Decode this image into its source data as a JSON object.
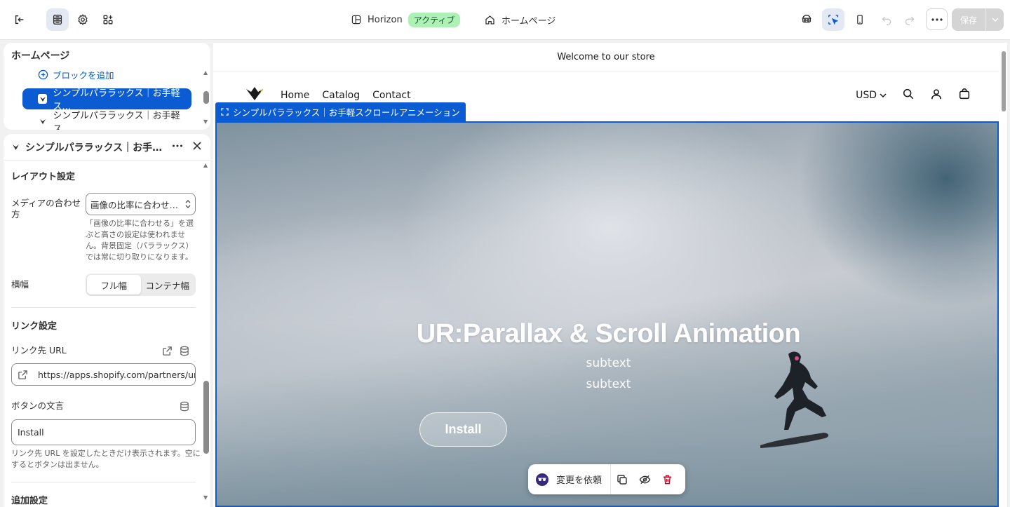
{
  "topbar": {
    "theme_name": "Horizon",
    "theme_status": "アクティブ",
    "page_name": "ホームページ",
    "save_label": "保存"
  },
  "sections_panel": {
    "title": "ホームページ",
    "add_block_label": "ブロックを追加",
    "items": [
      {
        "label": "シンプルパララックス｜お手軽ス…",
        "selected": true
      },
      {
        "label": "シンプルパララックス｜お手軽ス…",
        "selected": false
      }
    ]
  },
  "settings_panel": {
    "title": "シンプルパララックス｜お手…",
    "layout_section": "レイアウト設定",
    "media_fit_label": "メディアの合わせ方",
    "media_fit_value": "画像の比率に合わせ…",
    "media_fit_help": "「画像の比率に合わせる」を選ぶと高さの設定は使われません。背景固定（パララックス）では常に切り取りになります。",
    "width_label": "横幅",
    "width_options": [
      "フル幅",
      "コンテナ幅"
    ],
    "width_selected": "フル幅",
    "link_section": "リンク設定",
    "link_url_label": "リンク先 URL",
    "link_url_value": "https://apps.shopify.com/partners/un",
    "button_text_label": "ボタンの文言",
    "button_text_value": "Install",
    "button_text_help": "リンク先 URL を設定したときだけ表示されます。空にするとボタンは出ません。",
    "extra_section": "追加設定"
  },
  "preview": {
    "announcement": "Welcome to our store",
    "nav": [
      "Home",
      "Catalog",
      "Contact"
    ],
    "currency": "USD",
    "selected_section_tag": "シンプルパララックス｜お手軽スクロールアニメーション",
    "hero_title": "UR:Parallax & Scroll Animation",
    "hero_sub1": "subtext",
    "hero_sub2": "subtext",
    "hero_button": "Install"
  },
  "floating_toolbar": {
    "ask_label": "変更を依頼"
  },
  "colors": {
    "accent": "#0b5bd3",
    "active_badge": "#aff0b5",
    "delete": "#c70a24"
  }
}
